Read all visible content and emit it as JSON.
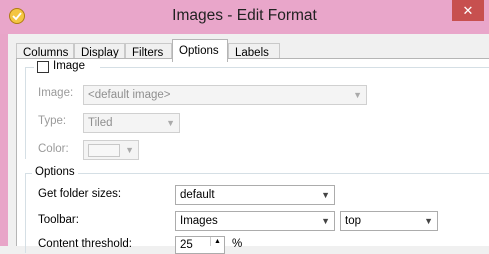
{
  "window": {
    "title": "Images - Edit Format",
    "close_label": "✕"
  },
  "tabs": [
    "Columns",
    "Display",
    "Filters",
    "Options",
    "Labels"
  ],
  "image_group": {
    "checkbox_label": "Image",
    "image_label": "Image:",
    "image_value": "<default image>",
    "type_label": "Type:",
    "type_value": "Tiled",
    "color_label": "Color:"
  },
  "options_group": {
    "caption": "Options",
    "folder_sizes_label": "Get folder sizes:",
    "folder_sizes_value": "default",
    "toolbar_label": "Toolbar:",
    "toolbar_value": "Images",
    "toolbar_position_value": "top",
    "content_threshold_label": "Content threshold:",
    "content_threshold_value": "25",
    "content_threshold_unit": "%"
  }
}
